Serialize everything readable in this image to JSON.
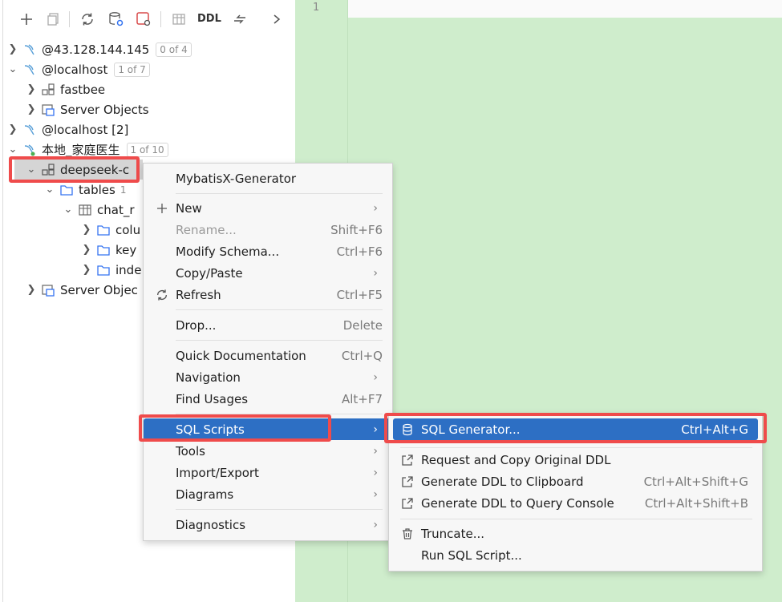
{
  "toolbar": {
    "ddl_label": "DDL",
    "icons": [
      "plus-icon",
      "copy-icon",
      "refresh-icon",
      "db-settings-icon",
      "jump-icon",
      "table-icon",
      "arrows-icon",
      "chevron-right-icon"
    ]
  },
  "tree": [
    {
      "label": "@43.128.144.145",
      "count": "0 of 4"
    },
    {
      "label": "@localhost",
      "count": "1 of 7"
    },
    {
      "label": "fastbee"
    },
    {
      "label": "Server Objects"
    },
    {
      "label": "@localhost [2]"
    },
    {
      "label": "本地_家庭医生",
      "count": "1 of 10"
    },
    {
      "label": "deepseek-c"
    },
    {
      "label": "tables",
      "count": "1"
    },
    {
      "label": "chat_r"
    },
    {
      "label": "colu"
    },
    {
      "label": "key"
    },
    {
      "label": "inde"
    },
    {
      "label": "Server Objec"
    }
  ],
  "editor": {
    "line_number": "1"
  },
  "context_menu": {
    "items": [
      {
        "label": "MybatisX-Generator"
      },
      {
        "label": "New"
      },
      {
        "label": "Rename...",
        "shortcut": "Shift+F6"
      },
      {
        "label": "Modify Schema...",
        "shortcut": "Ctrl+F6"
      },
      {
        "label": "Copy/Paste"
      },
      {
        "label": "Refresh",
        "shortcut": "Ctrl+F5"
      },
      {
        "label": "Drop...",
        "shortcut": "Delete"
      },
      {
        "label": "Quick Documentation",
        "shortcut": "Ctrl+Q"
      },
      {
        "label": "Navigation"
      },
      {
        "label": "Find Usages",
        "shortcut": "Alt+F7"
      },
      {
        "label": "SQL Scripts"
      },
      {
        "label": "Tools"
      },
      {
        "label": "Import/Export"
      },
      {
        "label": "Diagrams"
      },
      {
        "label": "Diagnostics"
      }
    ]
  },
  "submenu": {
    "items": [
      {
        "label": "SQL Generator...",
        "shortcut": "Ctrl+Alt+G"
      },
      {
        "label": "Request and Copy Original DDL"
      },
      {
        "label": "Generate DDL to Clipboard",
        "shortcut": "Ctrl+Alt+Shift+G"
      },
      {
        "label": "Generate DDL to Query Console",
        "shortcut": "Ctrl+Alt+Shift+B"
      },
      {
        "label": "Truncate..."
      },
      {
        "label": "Run SQL Script..."
      }
    ]
  },
  "colors": {
    "accent": "#2d6fc4",
    "highlight": "#ef4b4b",
    "editor_bg": "#cfedcc"
  }
}
